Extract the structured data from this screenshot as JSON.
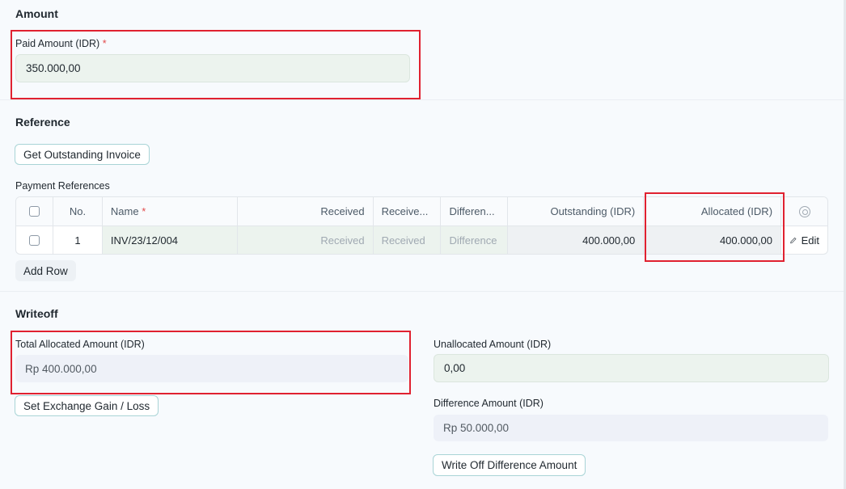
{
  "amount": {
    "title": "Amount",
    "paid_label": "Paid Amount (IDR)",
    "required_mark": "*",
    "paid_value": "350.000,00"
  },
  "reference": {
    "title": "Reference",
    "get_outstanding_label": "Get Outstanding Invoice",
    "table_label": "Payment References",
    "columns": {
      "no": "No.",
      "name": "Name",
      "received": "Received",
      "received2": "Receive...",
      "difference": "Differen...",
      "outstanding": "Outstanding (IDR)",
      "allocated": "Allocated (IDR)"
    },
    "rows": [
      {
        "no": "1",
        "name": "INV/23/12/004",
        "received": "Received",
        "received2": "Received",
        "difference": "Difference",
        "outstanding": "400.000,00",
        "allocated": "400.000,00",
        "edit": "Edit"
      }
    ],
    "add_row_label": "Add Row"
  },
  "writeoff": {
    "title": "Writeoff",
    "total_allocated_label": "Total Allocated Amount (IDR)",
    "total_allocated_value": "Rp 400.000,00",
    "unallocated_label": "Unallocated Amount (IDR)",
    "unallocated_value": "0,00",
    "difference_label": "Difference Amount (IDR)",
    "difference_value": "Rp 50.000,00",
    "exchange_button": "Set Exchange Gain / Loss",
    "writeoff_button": "Write Off Difference Amount"
  },
  "colors": {
    "highlight": "#e02130",
    "required": "#e24c4c",
    "field_green": "#ecf3ee",
    "field_grey": "#eef1f8"
  }
}
